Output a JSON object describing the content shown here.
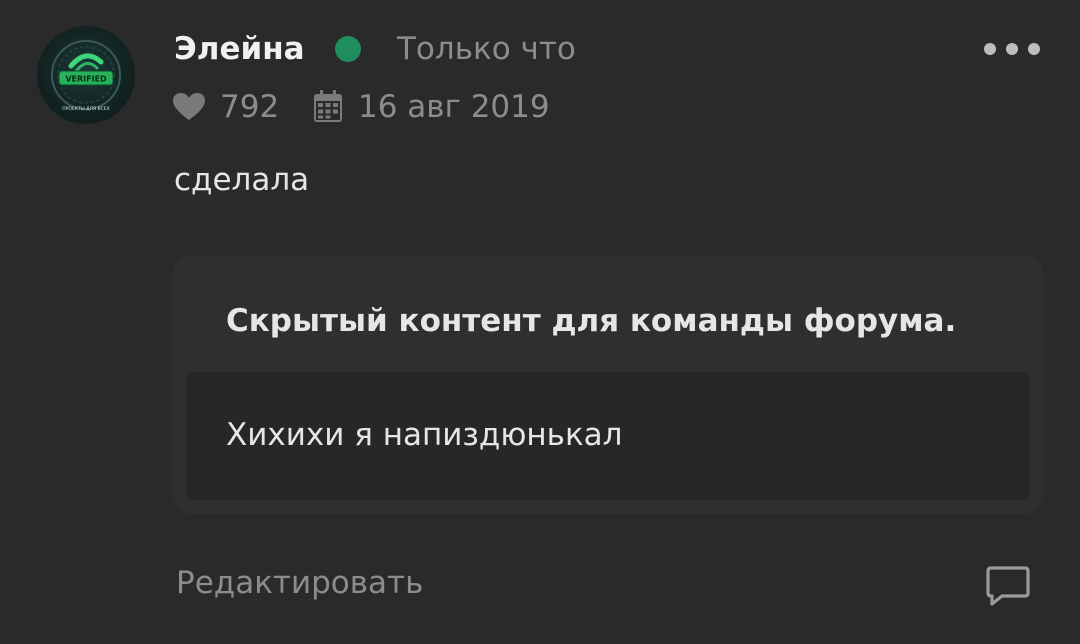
{
  "post": {
    "author": "Элейна",
    "time": "Только что",
    "likes": "792",
    "date": "16 авг 2019",
    "content": "сделала",
    "status_color": "#1f8f5f",
    "avatar": {
      "badge_text": "VERIFIED",
      "caption": "ПРОЕКТЫ ДЛЯ ВСЕХ"
    }
  },
  "hidden_block": {
    "title": "Скрытый контент для команды форума.",
    "text": "Хихихи я напиздюнькал"
  },
  "actions": {
    "edit_label": "Редактировать",
    "more_icon": "more-horizontal-icon",
    "reply_icon": "comment-icon"
  }
}
